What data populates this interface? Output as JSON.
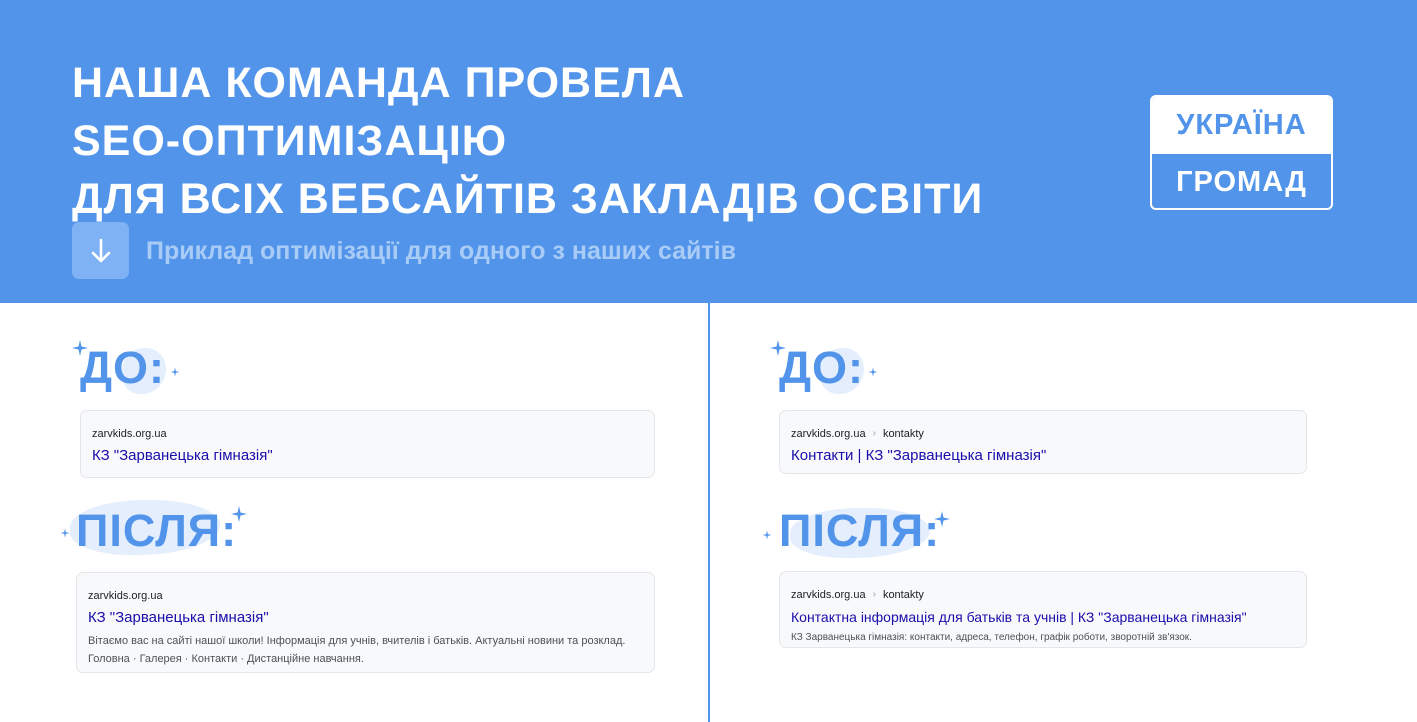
{
  "header": {
    "headline": [
      "НАША КОМАНДА ПРОВЕЛА",
      "SEO-ОПТИМІЗАЦІЮ",
      "ДЛЯ ВСІХ ВЕБСАЙТІВ ЗАКЛАДІВ ОСВІТИ"
    ],
    "subtitle": "Приклад оптимізації для одного з наших сайтів",
    "download_icon": "arrow-down-icon",
    "logo": {
      "top": "УКРАЇНА",
      "bottom": "ГРОМАД"
    }
  },
  "left": {
    "before_label": "ДО:",
    "after_label": "ПІСЛЯ:",
    "before_card": {
      "url": "zarvkids.org.ua",
      "title": "КЗ \"Зарванецька гімназія\""
    },
    "after_card": {
      "url": "zarvkids.org.ua",
      "title": "КЗ \"Зарванецька гімназія\"",
      "snippet": "Вітаємо вас на сайті нашої школи! Інформація для учнів, вчителів і батьків. Актуальні новини та розклад.",
      "links": "Головна · Галерея · Контакти · Дистанційне навчання."
    }
  },
  "right": {
    "before_label": "ДО:",
    "after_label": "ПІСЛЯ:",
    "before_card": {
      "url": "zarvkids.org.ua",
      "separator": "›",
      "path": "kontakty",
      "title": "Контакти | КЗ \"Зарванецька гімназія\""
    },
    "after_card": {
      "url": "zarvkids.org.ua",
      "separator": "›",
      "path": "kontakty",
      "title": "Контактна інформація для батьків та учнів | КЗ \"Зарванецька гімназія\"",
      "snippet": "КЗ Зарванецька гімназія: контакти, адреса, телефон, графік роботи, зворотній зв'язок."
    }
  },
  "colors": {
    "brand_blue": "#5194ea",
    "link_blue": "#1a0dab",
    "card_bg": "#f8f9fa"
  }
}
